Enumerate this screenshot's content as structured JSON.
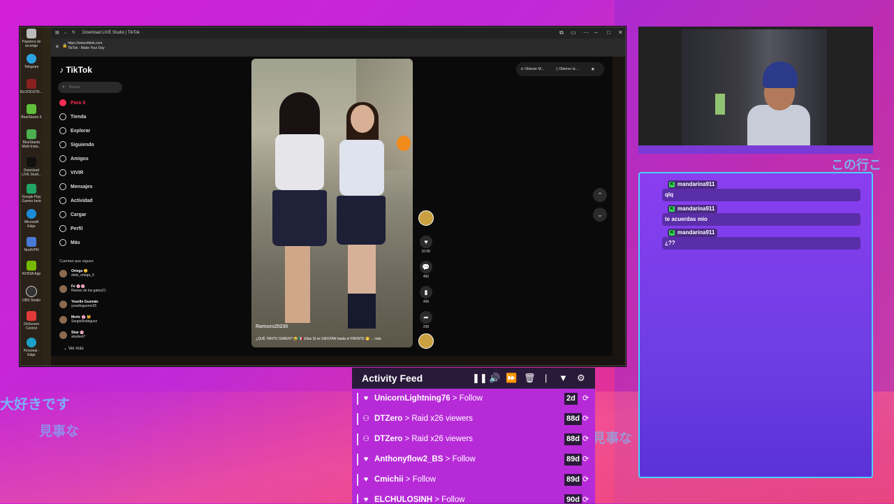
{
  "overlay": {
    "jp_text_1": "大好きです",
    "jp_text_2": "見事な",
    "jp_text_3": "見事な",
    "jp_text_4": "この行こ"
  },
  "desktop": {
    "icons": [
      "Papelera de reciclaje",
      "Telegram",
      "BLOODSTR...",
      "BlueStacks 5",
      "BlueStacks Multi-Insta...",
      "Download LIVE Studi...",
      "Google Play Games beta",
      "Microsoft Edge",
      "NordVPN",
      "NVIDIA App",
      "OBS Studio",
      "OnScreen Control",
      "Personal - Edge"
    ]
  },
  "browser": {
    "title": "Download LIVE Studio | TikTok",
    "url": "https://www.tiktok.com",
    "page_title": "TikTok - Make Your Day"
  },
  "tiktok": {
    "logo": "TikTok",
    "search_placeholder": "Buscar",
    "nav": [
      {
        "label": "Para ti"
      },
      {
        "label": "Tienda"
      },
      {
        "label": "Explorar"
      },
      {
        "label": "Siguiendo"
      },
      {
        "label": "Amigos"
      },
      {
        "label": "VIVIR"
      },
      {
        "label": "Mensajes"
      },
      {
        "label": "Actividad"
      },
      {
        "label": "Cargar"
      },
      {
        "label": "Perfil"
      },
      {
        "label": "Más"
      }
    ],
    "following_title": "Cuentas que sigues",
    "following": [
      {
        "name": "Ortega 😊",
        "handle": "delsi_ortega_0"
      },
      {
        "name": "Fe 🌸🌸",
        "handle": "Reinas de los gatos21"
      },
      {
        "name": "Yoselin Guzmán",
        "handle": "yoselinguzmn25"
      },
      {
        "name": "Mvrle 🌸 🐱",
        "handle": "SergioRodriguez"
      },
      {
        "name": "Skar 🌸",
        "handle": "skarleet7"
      }
    ],
    "ver_mas": "Ver más",
    "top_buttons": [
      "Obtener M...",
      "Obtener la ..."
    ],
    "video": {
      "username": "Ramses20230",
      "caption": "¿QUÉ TANTO SABEN? 😂 🇲🇽 Ellas Si se SIENTAN hasta el FRENTE 🤭 ... más"
    },
    "actions": {
      "likes": "10.5K",
      "comments": "482",
      "saves": "496",
      "shares": "209"
    }
  },
  "chat": {
    "messages": [
      {
        "user": "mandarina911",
        "text": "qlq"
      },
      {
        "user": "mandarina911",
        "text": "te acuerdas mío"
      },
      {
        "user": "mandarina911",
        "text": "¿??"
      }
    ]
  },
  "activity_feed": {
    "title": "Activity Feed",
    "rows": [
      {
        "icon": "heart-icon",
        "user": "UnicornLightning76",
        "action": "Follow",
        "age": "2d"
      },
      {
        "icon": "people-icon",
        "user": "DTZero",
        "action": "Raid x26 viewers",
        "age": "88d"
      },
      {
        "icon": "people-icon",
        "user": "DTZero",
        "action": "Raid x26 viewers",
        "age": "88d"
      },
      {
        "icon": "heart-icon",
        "user": "Anthonyflow2_BS",
        "action": "Follow",
        "age": "89d"
      },
      {
        "icon": "heart-icon",
        "user": "Cmichii",
        "action": "Follow",
        "age": "89d"
      },
      {
        "icon": "heart-icon",
        "user": "ELCHULOSINH",
        "action": "Follow",
        "age": "90d"
      }
    ]
  }
}
